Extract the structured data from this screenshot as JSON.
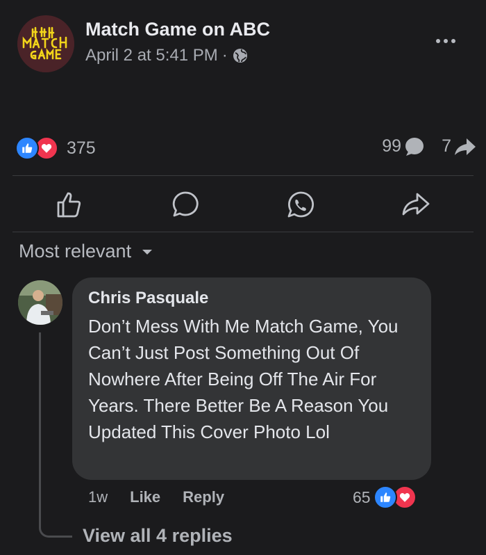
{
  "post": {
    "page_name": "Match Game on ABC",
    "timestamp": "April 2 at 5:41 PM",
    "separator": "·",
    "audience_icon": "globe-icon",
    "avatar_logo_text": [
      "M",
      "A",
      "T",
      "C",
      "H",
      "G",
      "A",
      "M",
      "E"
    ]
  },
  "stats": {
    "reactions_count": "375",
    "reaction_types": [
      "like",
      "love"
    ],
    "comments_count": "99",
    "shares_count": "7"
  },
  "actions": [
    {
      "name": "like",
      "icon": "thumbs-up-icon"
    },
    {
      "name": "comment",
      "icon": "comment-bubble-icon"
    },
    {
      "name": "whatsapp",
      "icon": "whatsapp-icon"
    },
    {
      "name": "share",
      "icon": "share-arrow-icon"
    }
  ],
  "sort": {
    "label": "Most relevant"
  },
  "comment": {
    "author": "Chris Pasquale",
    "text": "Don’t Mess With Me Match Game, You Can’t Just Post Something Out Of Nowhere After Being Off The Air For Years. There Better Be A Reason You Updated This Cover Photo Lol",
    "time": "1w",
    "like_label": "Like",
    "reply_label": "Reply",
    "reactions_count": "65"
  },
  "replies": {
    "label": "View all 4 replies"
  },
  "colors": {
    "background": "#1b1b1d",
    "like_blue": "#2d86ff",
    "love_red": "#f0354f",
    "logo_yellow": "#f2d51a",
    "bubble": "#333436"
  }
}
